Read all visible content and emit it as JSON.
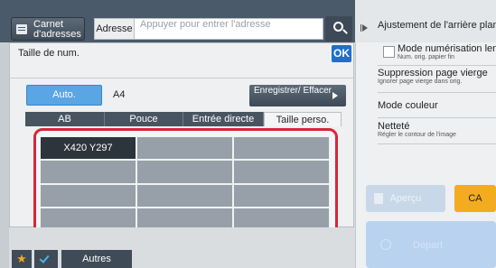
{
  "header": {
    "address_book_label": "Carnet d'adresses",
    "address_label": "Adresse",
    "address_placeholder": "Appuyer pour entrer l'adresse"
  },
  "dialog": {
    "title": "Taille de num.",
    "ok_label": "OK",
    "auto_label": "Auto.",
    "auto_value": "A4",
    "register_label": "Enregistrer/ Effacer",
    "tabs": [
      {
        "label": "AB",
        "active": false
      },
      {
        "label": "Pouce",
        "active": false
      },
      {
        "label": "Entrée directe",
        "active": false
      },
      {
        "label": "Taille perso.",
        "active": true
      }
    ],
    "custom_sizes": [
      "X420 Y297",
      "",
      "",
      "",
      "",
      "",
      "",
      "",
      "",
      "",
      "",
      ""
    ]
  },
  "bottom": {
    "others_label": "Autres"
  },
  "right_panel": {
    "items": [
      {
        "main": "Ajustement de l'arrière plan",
        "sub": ""
      },
      {
        "main": "Mode numérisation lente",
        "sub": "Num. orig. papier fin"
      },
      {
        "main": "Suppression page vierge",
        "sub": "Ignorer page vierge dans orig."
      },
      {
        "main": "Mode couleur",
        "sub": ""
      },
      {
        "main": "Netteté",
        "sub": "Régler le contour de l'image"
      }
    ],
    "preview_label": "Aperçu",
    "ca_label": "CA",
    "start_label": "Départ"
  },
  "colors": {
    "accent_blue": "#1d6fd1",
    "highlight_red": "#d8263a",
    "ca_orange": "#f3ac1f"
  }
}
